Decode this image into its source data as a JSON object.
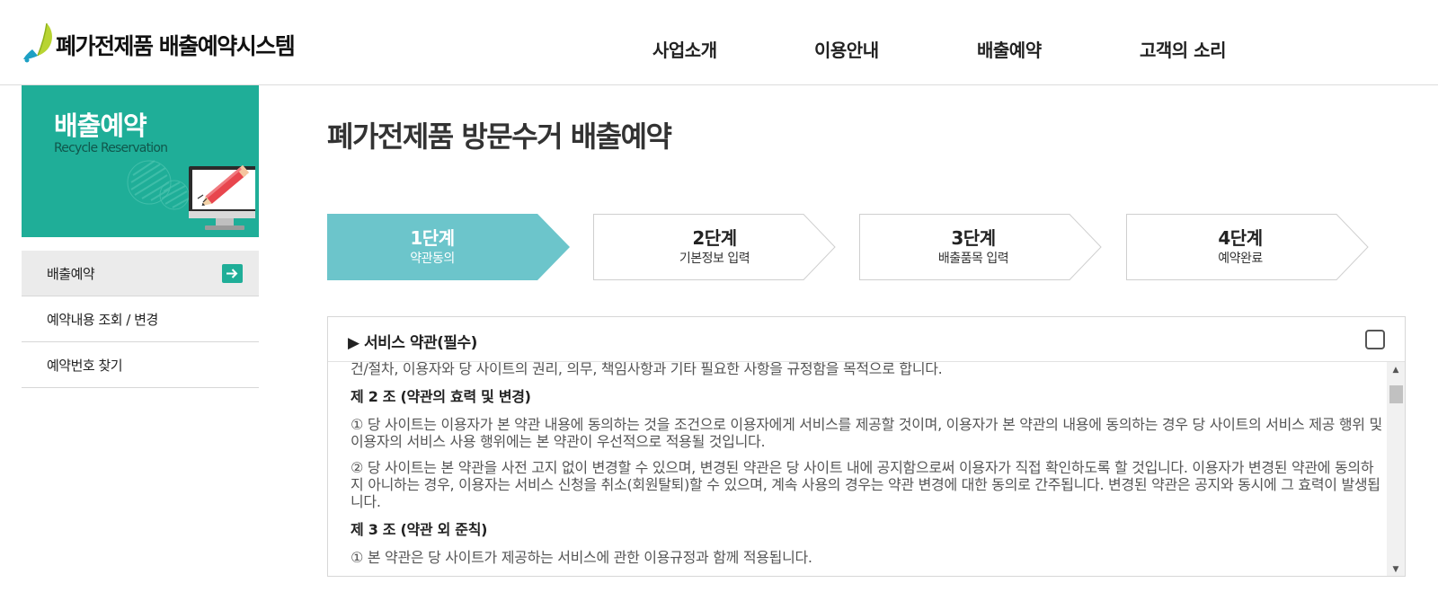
{
  "header": {
    "logo_text": "폐가전제품 배출예약시스템",
    "nav": [
      "사업소개",
      "이용안내",
      "배출예약",
      "고객의 소리"
    ]
  },
  "sidebar": {
    "title": "배출예약",
    "subtitle": "Recycle Reservation",
    "items": [
      {
        "label": "배출예약",
        "active": true
      },
      {
        "label": "예약내용 조회 / 변경",
        "active": false
      },
      {
        "label": "예약번호 찾기",
        "active": false
      }
    ]
  },
  "main": {
    "page_title": "폐가전제품 방문수거 배출예약",
    "steps": [
      {
        "num": "1단계",
        "label": "약관동의",
        "active": true
      },
      {
        "num": "2단계",
        "label": "기본정보 입력",
        "active": false
      },
      {
        "num": "3단계",
        "label": "배출품목 입력",
        "active": false
      },
      {
        "num": "4단계",
        "label": "예약완료",
        "active": false
      }
    ],
    "terms": {
      "title": "▶ 서비스 약관(필수)",
      "checked": false,
      "lines": [
        "건/절차, 이용자와 당 사이트의 권리, 의무, 책임사항과 기타 필요한 사항을 규정함을 목적으로 합니다.",
        "제 2 조 (약관의 효력 및 변경)",
        "① 당 사이트는 이용자가 본 약관 내용에 동의하는 것을 조건으로 이용자에게 서비스를 제공할 것이며, 이용자가 본 약관의 내용에 동의하는 경우 당 사이트의 서비스 제공 행위 및 이용자의 서비스 사용 행위에는 본 약관이 우선적으로 적용될 것입니다.",
        "② 당 사이트는 본 약관을 사전 고지 없이 변경할 수 있으며, 변경된 약관은 당 사이트 내에 공지함으로써 이용자가 직접 확인하도록 할 것입니다. 이용자가 변경된 약관에 동의하지 아니하는 경우, 이용자는 서비스 신청을 취소(회원탈퇴)할 수 있으며, 계속 사용의 경우는 약관 변경에 대한 동의로 간주됩니다. 변경된 약관은 공지와 동시에 그 효력이 발생됩니다.",
        "제 3 조 (약관 외 준칙)",
        "① 본 약관은 당 사이트가 제공하는 서비스에 관한 이용규정과 함께 적용됩니다."
      ]
    }
  },
  "colors": {
    "accent": "#1fae98",
    "step_active": "#6cc5cb"
  }
}
